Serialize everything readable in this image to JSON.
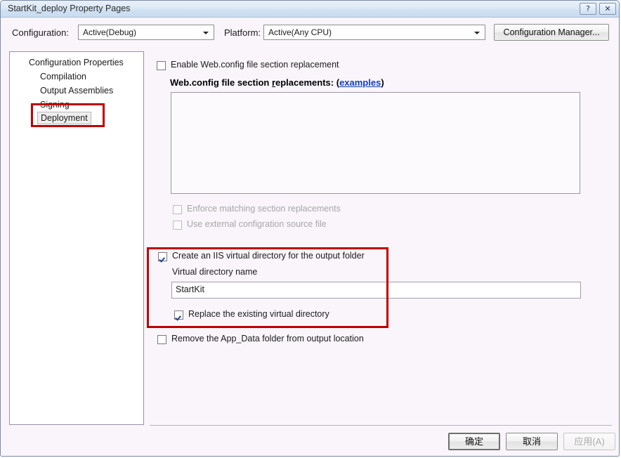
{
  "window": {
    "title": "StartKit_deploy Property Pages",
    "help_button": "?",
    "close_button": "✕"
  },
  "toolbar": {
    "configuration_label": "Configuration:",
    "configuration_value": "Active(Debug)",
    "platform_label": "Platform:",
    "platform_value": "Active(Any CPU)",
    "configuration_manager_label": "Configuration Manager..."
  },
  "tree": {
    "root_label": "Configuration Properties",
    "items": [
      {
        "label": "Compilation",
        "selected": false
      },
      {
        "label": "Output Assemblies",
        "selected": false
      },
      {
        "label": "Signing",
        "selected": false
      },
      {
        "label": "Deployment",
        "selected": true
      }
    ]
  },
  "main": {
    "enable_replacement_label": "Enable Web.config file section replacement",
    "enable_replacement_checked": false,
    "replacements_heading_prefix": "Web.config file section ",
    "replacements_heading_underlined": "r",
    "replacements_heading_suffix": "eplacements: (",
    "replacements_link": "examples",
    "replacements_heading_end": ")",
    "replacements_textarea_value": "",
    "enforce_matching_label": "Enforce matching section replacements",
    "enforce_matching_checked": false,
    "enforce_matching_disabled": true,
    "external_config_label": "Use external configration source file",
    "external_config_checked": false,
    "external_config_disabled": true,
    "create_iis_label": "Create an IIS virtual directory for the output folder",
    "create_iis_checked": true,
    "virtual_directory_name_label": "Virtual directory name",
    "virtual_directory_name_value": "StartKit",
    "replace_existing_label": "Replace the existing virtual directory",
    "replace_existing_checked": true,
    "remove_appdata_label": "Remove the App_Data folder from output location",
    "remove_appdata_checked": false
  },
  "footer": {
    "ok_label": "确定",
    "cancel_label": "取消",
    "apply_label": "应用(A)",
    "apply_disabled": true
  },
  "annotations": {
    "tree_highlight_color": "#c00000",
    "iis_section_highlight_color": "#c00000"
  }
}
